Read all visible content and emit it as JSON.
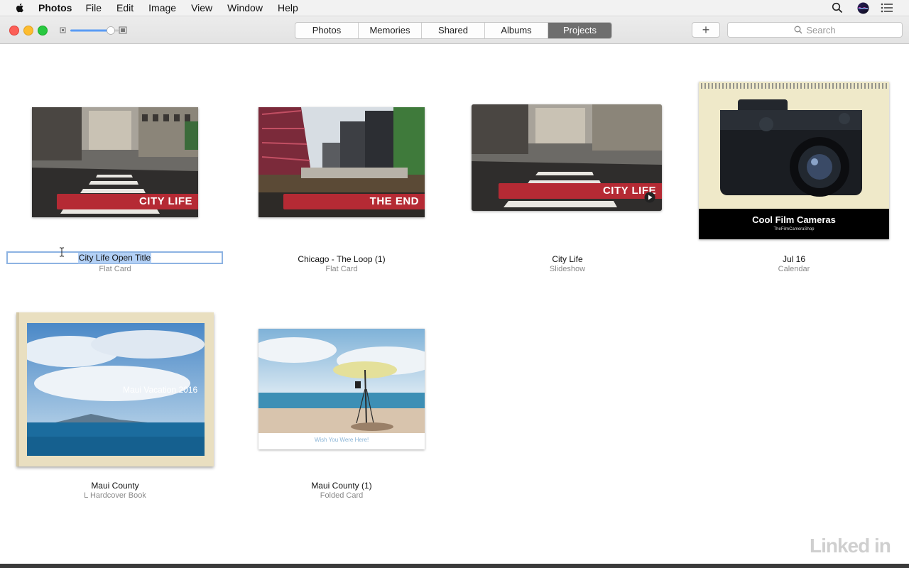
{
  "menubar": {
    "app_name": "Photos",
    "items": [
      "File",
      "Edit",
      "Image",
      "View",
      "Window",
      "Help"
    ]
  },
  "toolbar": {
    "tabs": [
      {
        "label": "Photos",
        "active": false
      },
      {
        "label": "Memories",
        "active": false
      },
      {
        "label": "Shared",
        "active": false
      },
      {
        "label": "Albums",
        "active": false
      },
      {
        "label": "Projects",
        "active": true
      }
    ],
    "add_label": "+",
    "search_placeholder": "Search"
  },
  "projects": [
    {
      "title": "City Life Open Title",
      "type": "Flat Card",
      "overlay": "City Life",
      "editing": true
    },
    {
      "title": "Chicago - The Loop (1)",
      "type": "Flat Card",
      "overlay": "The End"
    },
    {
      "title": "City Life",
      "type": "Slideshow",
      "overlay": "City Life"
    },
    {
      "title": "Jul 16",
      "type": "Calendar",
      "overlay": "Cool Film Cameras",
      "overlay_sub": "TheFilmCameraShop"
    },
    {
      "title": "Maui County",
      "type": "L Hardcover Book",
      "overlay": "Maui Vacation 2016"
    },
    {
      "title": "Maui County (1)",
      "type": "Folded Card",
      "overlay": "Wish You Were Here!"
    }
  ],
  "watermark": "Linked in",
  "colors": {
    "accent_tab": "#6e6e6e",
    "selection": "#b3d0f5",
    "banner_red": "#b52a34"
  }
}
